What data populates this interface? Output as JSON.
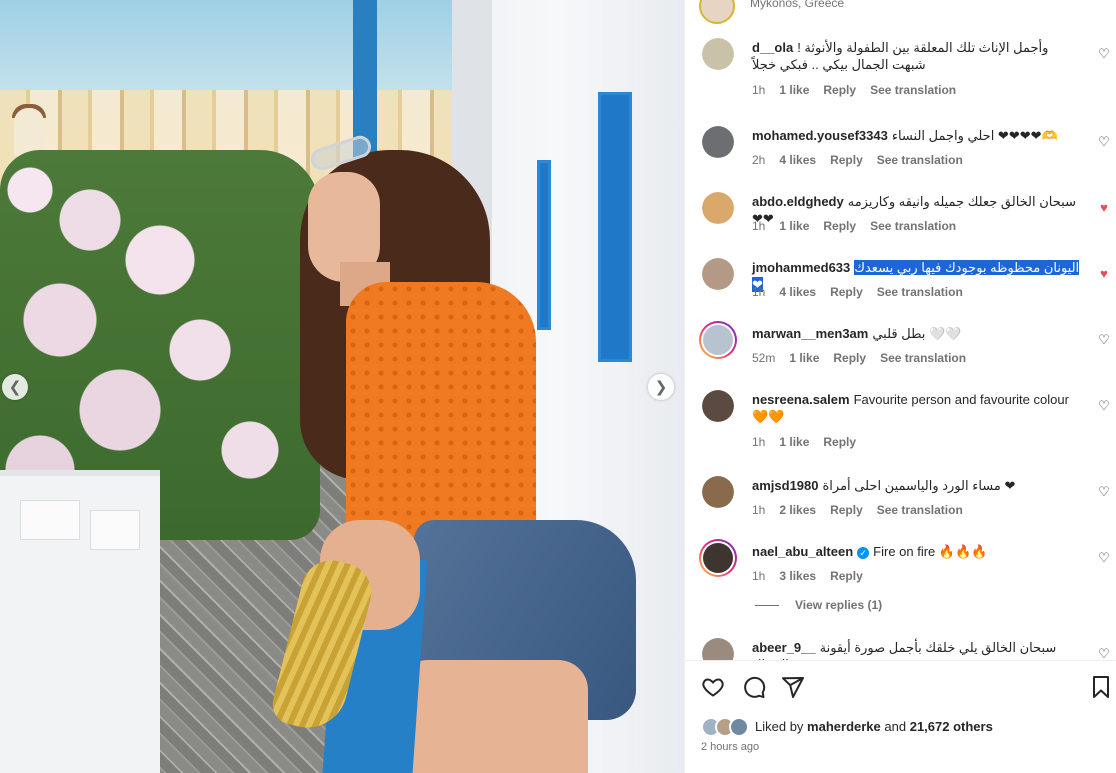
{
  "post": {
    "location": "Mykonos, Greece"
  },
  "comments": [
    {
      "user": "d__ola",
      "text": "وأجمل الإناث تلك المعلقة بين الطفولة والأنوثة ! شبهت الجمال بيكي .. فبكي خجلاً",
      "time": "1h",
      "likes": "1 like",
      "reply": "Reply",
      "translate": "See translation",
      "liked": false,
      "verified": false,
      "rtl": true,
      "highlight": false,
      "avatar_color": "#c9c2a8"
    },
    {
      "user": "mohamed.yousef3343",
      "text": "احلي واجمل النساء ❤❤❤❤🫶",
      "time": "2h",
      "likes": "4 likes",
      "reply": "Reply",
      "translate": "See translation",
      "liked": false,
      "verified": false,
      "rtl": true,
      "highlight": false,
      "avatar_color": "#6b6f72"
    },
    {
      "user": "abdo.eldghedy",
      "text": "سبحان الخالق جعلك جميله وانيقه وكاريزمه ❤❤",
      "time": "1h",
      "likes": "1 like",
      "reply": "Reply",
      "translate": "See translation",
      "liked": true,
      "verified": false,
      "rtl": true,
      "highlight": false,
      "avatar_color": "#d9a86a"
    },
    {
      "user": "jmohammed633",
      "text": "اليونان محظوظه بوجودك فيها ربي يسعدك ❤",
      "time": "1h",
      "likes": "4 likes",
      "reply": "Reply",
      "translate": "See translation",
      "liked": true,
      "verified": false,
      "rtl": true,
      "highlight": true,
      "avatar_color": "#b49a86"
    },
    {
      "user": "marwan__men3am",
      "text": "بطل قلبي 🤍🤍",
      "time": "52m",
      "likes": "1 like",
      "reply": "Reply",
      "translate": "See translation",
      "liked": false,
      "verified": false,
      "rtl": true,
      "highlight": false,
      "avatar_color": "#b9c3cf",
      "ring": true
    },
    {
      "user": "nesreena.salem",
      "text": "Favourite person and favourite colour 🧡🧡",
      "time": "1h",
      "likes": "1 like",
      "reply": "Reply",
      "translate": "",
      "liked": false,
      "verified": false,
      "rtl": false,
      "highlight": false,
      "avatar_color": "#5a4a3f"
    },
    {
      "user": "amjsd1980",
      "text": "مساء الورد والياسمين احلى أمراة ❤",
      "time": "1h",
      "likes": "2 likes",
      "reply": "Reply",
      "translate": "See translation",
      "liked": false,
      "verified": false,
      "rtl": true,
      "highlight": false,
      "avatar_color": "#8a6a4d"
    },
    {
      "user": "nael_abu_alteen",
      "text": "Fire on fire 🔥🔥🔥",
      "time": "1h",
      "likes": "3 likes",
      "reply": "Reply",
      "translate": "",
      "liked": false,
      "verified": true,
      "rtl": false,
      "highlight": false,
      "avatar_color": "#3e3530",
      "ring": true
    },
    {
      "user": "abeer_9__",
      "text": "سبحان الخالق يلي خلقك بأجمل صورة أيقونة الجمال ❤❤",
      "time": "",
      "likes": "",
      "reply": "",
      "translate": "",
      "liked": false,
      "verified": false,
      "rtl": true,
      "highlight": false,
      "avatar_color": "#9b8a7e"
    }
  ],
  "view_replies": "View replies (1)",
  "actions": {
    "liked_by_prefix": "Liked by",
    "liked_by_user": "maherderke",
    "liked_by_suffix": "and",
    "liked_by_count": "21,672 others",
    "time_ago": "2 hours ago"
  },
  "icons": [
    "heart-icon",
    "comment-icon",
    "share-icon",
    "bookmark-icon",
    "chevron-left-icon",
    "chevron-right-icon",
    "verified-icon"
  ]
}
